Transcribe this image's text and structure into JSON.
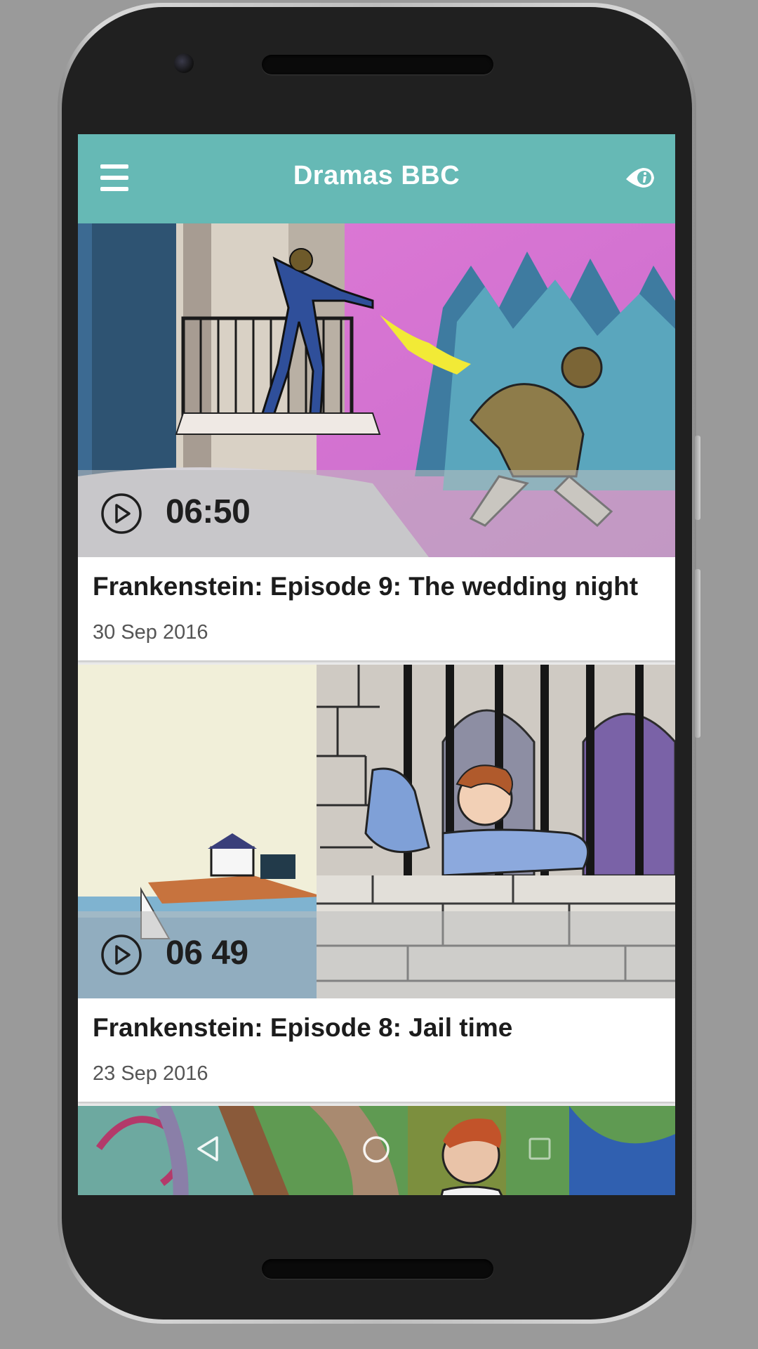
{
  "app": {
    "title": "Dramas BBC"
  },
  "header": {
    "menu_icon": "hamburger-menu-icon",
    "info_icon": "eye-info-icon",
    "accent_color": "#66b9b5"
  },
  "episodes": [
    {
      "duration": "06:50",
      "title": "Frankenstein: Episode 9: The wedding night",
      "date": "30 Sep 2016"
    },
    {
      "duration": "06 49",
      "title": "Frankenstein: Episode 8: Jail time",
      "date": "23 Sep 2016"
    }
  ],
  "navbar": {
    "icons": [
      "back-icon",
      "home-icon",
      "recents-icon"
    ]
  }
}
